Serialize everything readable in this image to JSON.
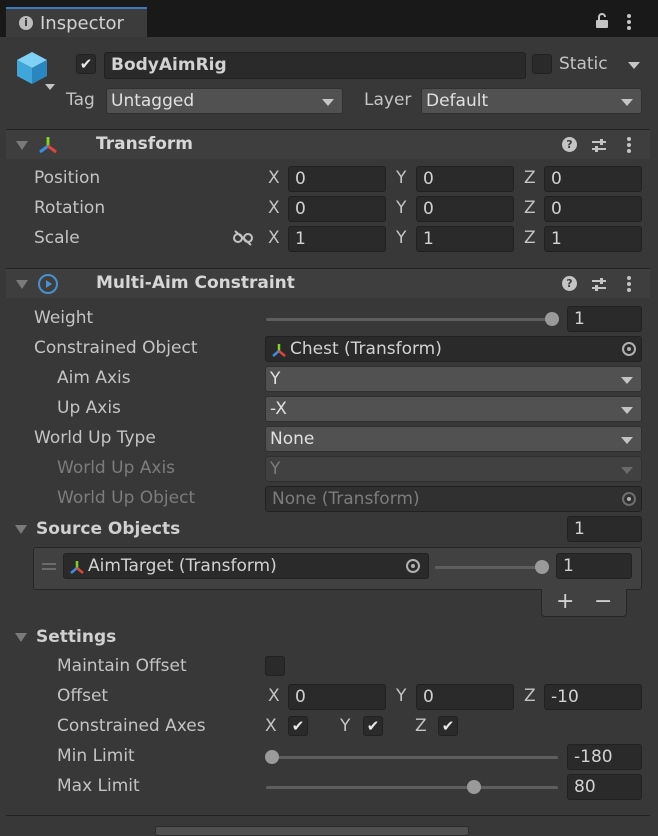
{
  "tab": {
    "title": "Inspector"
  },
  "object": {
    "name": "BodyAimRig",
    "active": true,
    "static_label": "Static",
    "tag_label": "Tag",
    "tag_value": "Untagged",
    "layer_label": "Layer",
    "layer_value": "Default"
  },
  "transform": {
    "title": "Transform",
    "rows": [
      {
        "label": "Position",
        "x": "0",
        "y": "0",
        "z": "0"
      },
      {
        "label": "Rotation",
        "x": "0",
        "y": "0",
        "z": "0"
      },
      {
        "label": "Scale",
        "x": "1",
        "y": "1",
        "z": "1"
      }
    ]
  },
  "axis_labels": {
    "x": "X",
    "y": "Y",
    "z": "Z"
  },
  "constraint": {
    "title": "Multi-Aim Constraint",
    "weight_label": "Weight",
    "weight_value": "1",
    "weight_fraction": 1.0,
    "constrained_object_label": "Constrained Object",
    "constrained_object_value": "Chest (Transform)",
    "aim_axis_label": "Aim Axis",
    "aim_axis_value": "Y",
    "up_axis_label": "Up Axis",
    "up_axis_value": "-X",
    "world_up_type_label": "World Up Type",
    "world_up_type_value": "None",
    "world_up_axis_label": "World Up Axis",
    "world_up_axis_value": "Y",
    "world_up_object_label": "World Up Object",
    "world_up_object_value": "None (Transform)"
  },
  "source_objects": {
    "title": "Source Objects",
    "count": "1",
    "items": [
      {
        "name": "AimTarget (Transform)",
        "weight": "1",
        "weight_fraction": 1.0
      }
    ],
    "add_label": "+",
    "remove_label": "−"
  },
  "settings": {
    "title": "Settings",
    "maintain_offset_label": "Maintain Offset",
    "maintain_offset": false,
    "offset_label": "Offset",
    "offset": {
      "x": "0",
      "y": "0",
      "z": "-10"
    },
    "constrained_axes_label": "Constrained Axes",
    "constrained_axes": {
      "x": true,
      "y": true,
      "z": true
    },
    "min_limit_label": "Min Limit",
    "min_limit_value": "-180",
    "max_limit_label": "Max Limit",
    "max_limit_value": "80",
    "limit_range": [
      -180,
      180
    ]
  }
}
